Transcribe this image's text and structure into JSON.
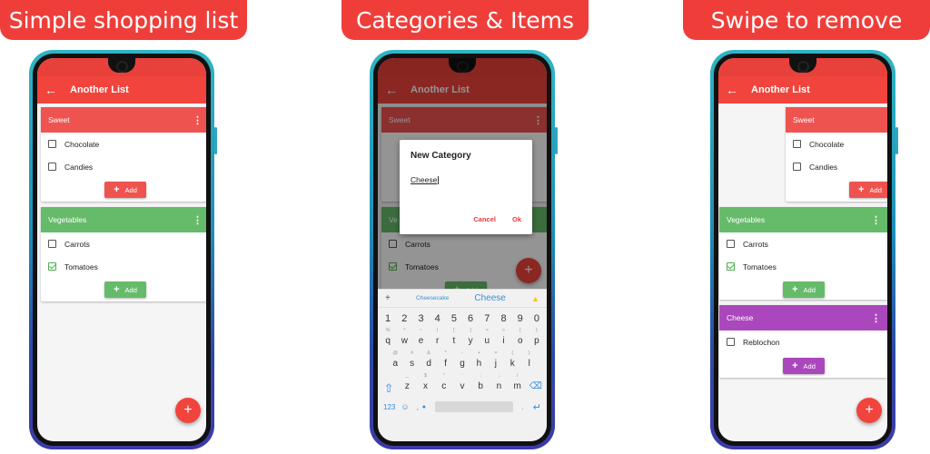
{
  "banners": {
    "p1": "Simple shopping list",
    "p2": "Categories & Items",
    "p3": "Swipe to remove"
  },
  "icons": {
    "back": "arrow-left-icon",
    "menu": "more-vert-icon",
    "plus": "plus-icon",
    "checkbox": "checkbox-icon",
    "fab": "add-fab-icon",
    "emoji": "emoji-icon",
    "mic": "mic-icon",
    "shift": "shift-icon",
    "backspace": "backspace-icon",
    "enter": "enter-icon",
    "cheese_emoji": "cheese-icon"
  },
  "colors": {
    "accent": "#f0443d",
    "sweet": "#ef5350",
    "vegetables": "#66bb6a",
    "cheese": "#ab47bc"
  },
  "screen1": {
    "appbar_title": "Another List",
    "sweet_title": "Sweet",
    "sweet_items": [
      "Chocolate",
      "Candies"
    ],
    "sweet_add": "Add",
    "veg_title": "Vegetables",
    "veg_items": [
      "Carrots",
      "Tomatoes"
    ],
    "veg_add": "Add",
    "fab": "+"
  },
  "screen2": {
    "appbar_title": "Another List",
    "sweet_title": "Sweet",
    "veg_title_partial": "Ve",
    "veg_items": [
      "Carrots",
      "Tomatoes"
    ],
    "veg_add": "Add",
    "dialog_title": "New Category",
    "dialog_input": "Cheese",
    "cancel": "Cancel",
    "ok": "Ok",
    "keyboard": {
      "suggestions": [
        "Cheesecake",
        "Cheese"
      ],
      "numbers": [
        "1",
        "2",
        "3",
        "4",
        "5",
        "6",
        "7",
        "8",
        "9",
        "0"
      ],
      "row1": [
        "q",
        "w",
        "e",
        "r",
        "t",
        "y",
        "u",
        "i",
        "o",
        "p"
      ],
      "row1_sym": [
        "%",
        "^",
        "~",
        "|",
        "[",
        "]",
        "<",
        ">",
        "{",
        "}"
      ],
      "row2": [
        "a",
        "s",
        "d",
        "f",
        "g",
        "h",
        "j",
        "k",
        "l"
      ],
      "row2_sym": [
        "@",
        "#",
        "&",
        "*",
        "-",
        "+",
        "=",
        "(",
        ")"
      ],
      "row3": [
        "z",
        "x",
        "c",
        "v",
        "b",
        "n",
        "m"
      ],
      "row3_sym": [
        "_",
        "$",
        "\"",
        "'",
        ":",
        ";",
        "/"
      ],
      "mode_key": "123",
      "comma": ",",
      "period": "."
    }
  },
  "screen3": {
    "appbar_title": "Another List",
    "sweet_title": "Sweet",
    "sweet_items": [
      "Chocolate",
      "Candies"
    ],
    "sweet_add": "Add",
    "veg_title": "Vegetables",
    "veg_items": [
      "Carrots",
      "Tomatoes"
    ],
    "veg_add": "Add",
    "cheese_title": "Cheese",
    "cheese_items": [
      "Reblochon"
    ],
    "cheese_add": "Add",
    "fab": "+"
  }
}
